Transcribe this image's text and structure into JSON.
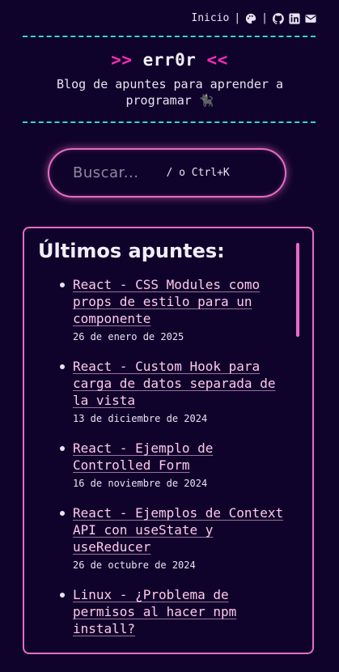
{
  "nav": {
    "home_label": "Inicio",
    "separator": "|",
    "icons": [
      "palette-icon",
      "github-icon",
      "linkedin-icon",
      "mail-icon"
    ]
  },
  "header": {
    "left_arrows": ">>",
    "name": "err0r",
    "right_arrows": "<<",
    "tagline": "Blog de apuntes para aprender a programar 🐈‍⬛"
  },
  "search": {
    "placeholder": "Buscar...",
    "hint": "/ o Ctrl+K"
  },
  "latest": {
    "heading": "Últimos apuntes:",
    "posts": [
      {
        "title": "React - CSS Modules como props de estilo para un componente",
        "date": "26 de enero de 2025"
      },
      {
        "title": "React - Custom Hook para carga de datos separada de la vista",
        "date": "13 de diciembre de 2024"
      },
      {
        "title": "React - Ejemplo de Controlled Form",
        "date": "16 de noviembre de 2024"
      },
      {
        "title": "React - Ejemplos de Context API con useState y useReducer",
        "date": "26 de octubre de 2024"
      },
      {
        "title": "Linux - ¿Problema de permisos al hacer npm install?",
        "date": ""
      }
    ]
  },
  "colors": {
    "background": "#10032b",
    "accent_pink": "#e86bc6",
    "accent_magenta": "#ff2ab8",
    "accent_cyan": "#2fd6d0",
    "link": "#ffc8ea"
  }
}
